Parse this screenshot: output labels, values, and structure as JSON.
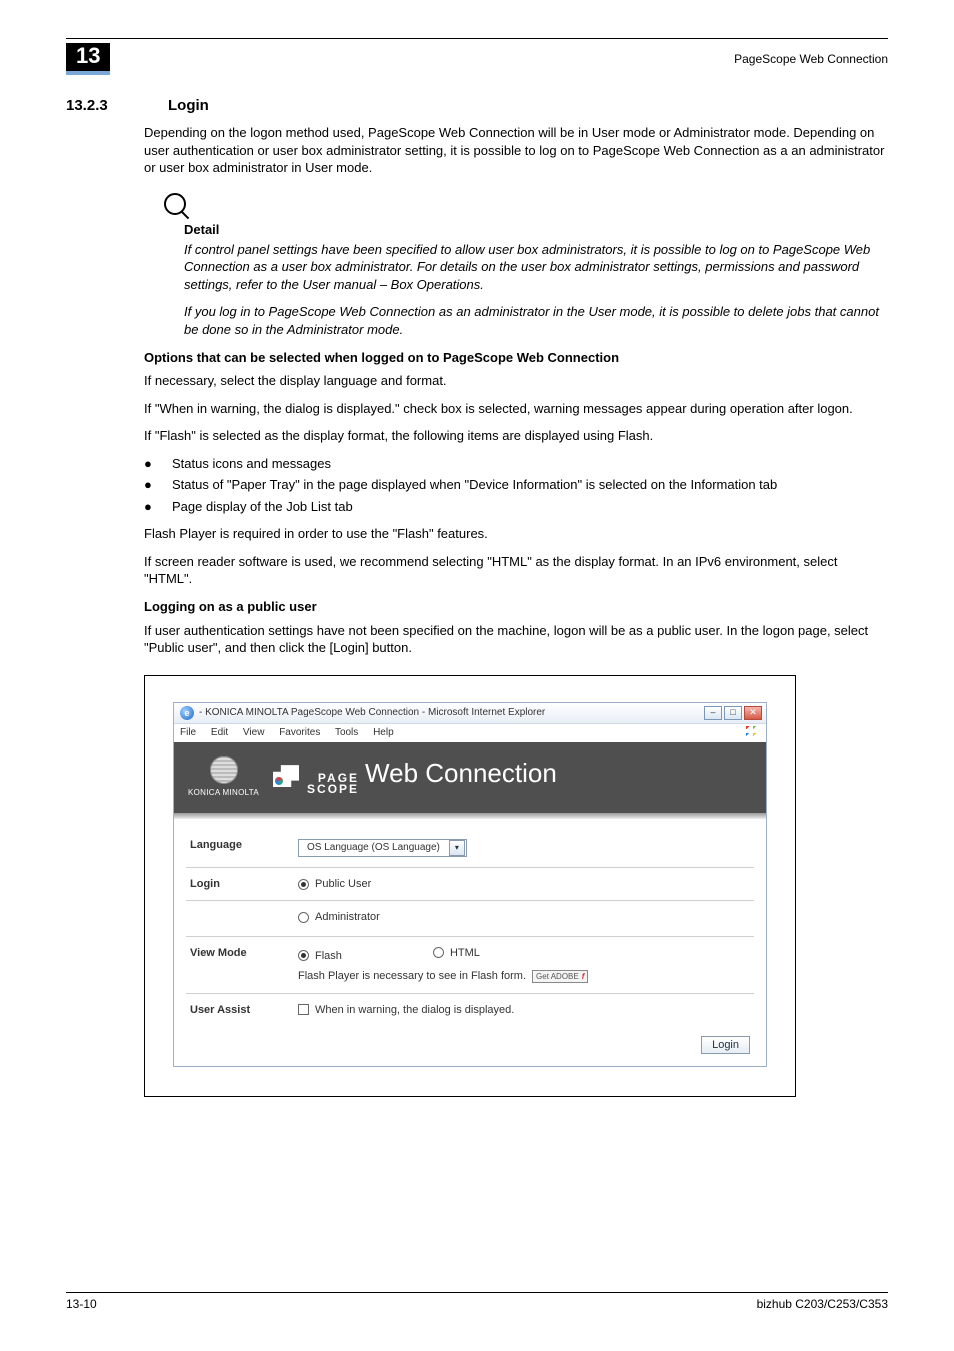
{
  "header": {
    "chapter_badge": "13",
    "breadcrumb": "PageScope Web Connection"
  },
  "section": {
    "number": "13.2.3",
    "title": "Login",
    "intro": "Depending on the logon method used, PageScope Web Connection will be in User mode or Administrator mode. Depending on user authentication or user box administrator setting, it is possible to log on to PageScope Web Connection as a an administrator or user box administrator in User mode."
  },
  "detail": {
    "label": "Detail",
    "p1": "If control panel settings have been specified to allow user box administrators, it is possible to log on to PageScope Web Connection as a user box administrator. For details on the user box administrator settings, permissions and password settings, refer to the User manual – Box Operations.",
    "p2": "If you log in to PageScope Web Connection as an administrator in the User mode, it is possible to delete jobs that cannot be done so in the Administrator mode."
  },
  "options": {
    "heading": "Options that can be selected when logged on to PageScope Web Connection",
    "p1": "If necessary, select the display language and format.",
    "p2": "If \"When in warning, the dialog is displayed.\" check box is selected, warning messages appear during operation after logon.",
    "p3": "If \"Flash\" is selected as the display format, the following items are displayed using Flash.",
    "bullets": [
      "Status icons and messages",
      "Status of \"Paper Tray\" in the page displayed when \"Device Information\" is selected on the Information tab",
      "Page display of the Job List tab"
    ],
    "p4": "Flash Player is required in order to use the \"Flash\" features.",
    "p5": "If screen reader software is used, we recommend selecting \"HTML\" as the display format. In an IPv6 environment, select \"HTML\"."
  },
  "public": {
    "heading": "Logging on as a public user",
    "p1": "If user authentication settings have not been specified on the machine, logon will be as a public user. In the logon page, select \"Public user\", and then click the [Login] button."
  },
  "screenshot": {
    "titlebar": " - KONICA MINOLTA PageScope Web Connection - Microsoft Internet Explorer",
    "menubar": [
      "File",
      "Edit",
      "View",
      "Favorites",
      "Tools",
      "Help"
    ],
    "logo_brand": "KONICA MINOLTA",
    "logo_page": "PAGE",
    "logo_scope": "SCOPE",
    "logo_wc": "Web Connection",
    "rows": {
      "language_label": "Language",
      "language_value": "OS Language (OS Language)",
      "login_label": "Login",
      "login_public": "Public User",
      "login_admin": "Administrator",
      "viewmode_label": "View Mode",
      "view_flash": "Flash",
      "view_html": "HTML",
      "flash_note": "Flash Player is necessary to see in Flash form.",
      "getflash_1": "Get ADOBE",
      "getflash_2": "FLASH PLAYER",
      "userassist_label": "User Assist",
      "userassist_text": "When in warning, the dialog is displayed."
    },
    "login_button": "Login"
  },
  "footer": {
    "left": "13-10",
    "right": "bizhub C203/C253/C353"
  }
}
